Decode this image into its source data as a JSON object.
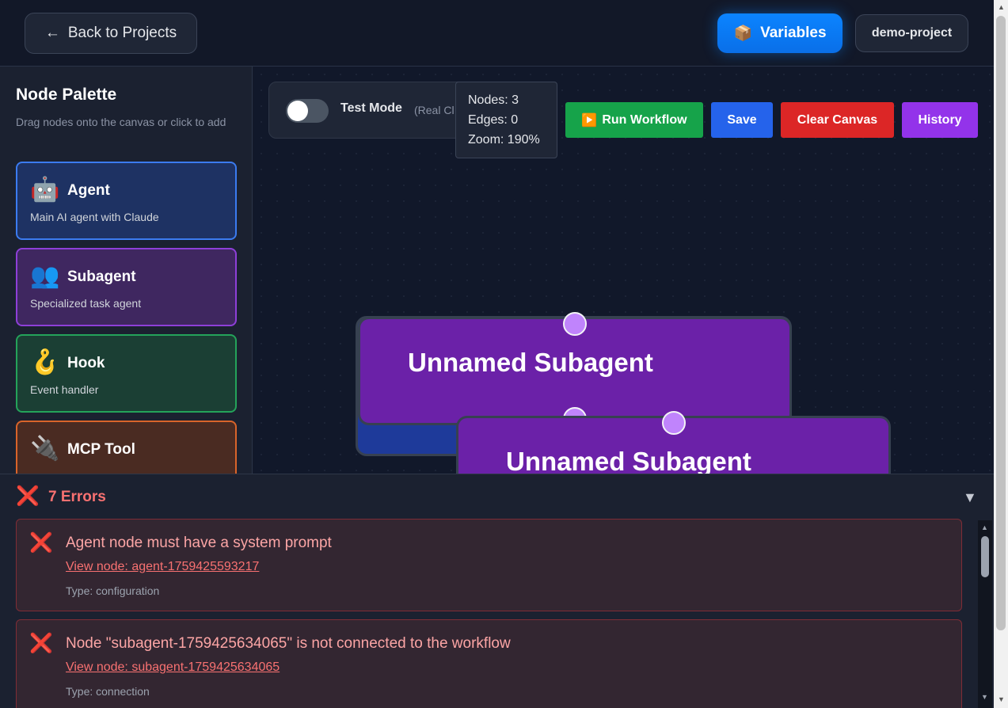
{
  "header": {
    "back_label": "Back to Projects",
    "back_icon": "←",
    "variables_label": "Variables",
    "variables_icon": "📦",
    "project_name": "demo-project"
  },
  "palette": {
    "title": "Node Palette",
    "subtitle": "Drag nodes onto the canvas or click to add",
    "items": [
      {
        "icon": "🤖",
        "name": "Agent",
        "desc": "Main AI agent with Claude"
      },
      {
        "icon": "👥",
        "name": "Subagent",
        "desc": "Specialized task agent"
      },
      {
        "icon": "🪝",
        "name": "Hook",
        "desc": "Event handler"
      },
      {
        "icon": "🔌",
        "name": "MCP Tool",
        "desc": ""
      }
    ]
  },
  "canvas": {
    "test_mode_label": "Test Mode",
    "test_mode_hint": "(Real Cl",
    "test_mode_on": false,
    "stats": {
      "nodes": "Nodes: 3",
      "edges": "Edges: 0",
      "zoom": "Zoom: 190%"
    },
    "buttons": {
      "run_icon": "▶️",
      "run": "Run Workflow",
      "save": "Save",
      "clear": "Clear Canvas",
      "history": "History"
    },
    "nodes": [
      {
        "title": "Unnamed Subagent"
      },
      {
        "title": "Unnamed Subagent"
      }
    ]
  },
  "errors": {
    "icon": "❌",
    "header": "7 Errors",
    "collapse_icon": "▼",
    "items": [
      {
        "message": "Agent node must have a system prompt",
        "link": "View node: agent-1759425593217",
        "type": "Type: configuration"
      },
      {
        "message": "Node \"subagent-1759425634065\" is not connected to the workflow",
        "link": "View node: subagent-1759425634065",
        "type": "Type: connection"
      }
    ]
  },
  "colors": {
    "accent_blue": "#0b84ff",
    "run_green": "#16a34a",
    "save_blue": "#2563eb",
    "clear_red": "#dc2626",
    "history_purple": "#9333ea",
    "node_purple": "#6b21a8",
    "error_text": "#f87171"
  }
}
